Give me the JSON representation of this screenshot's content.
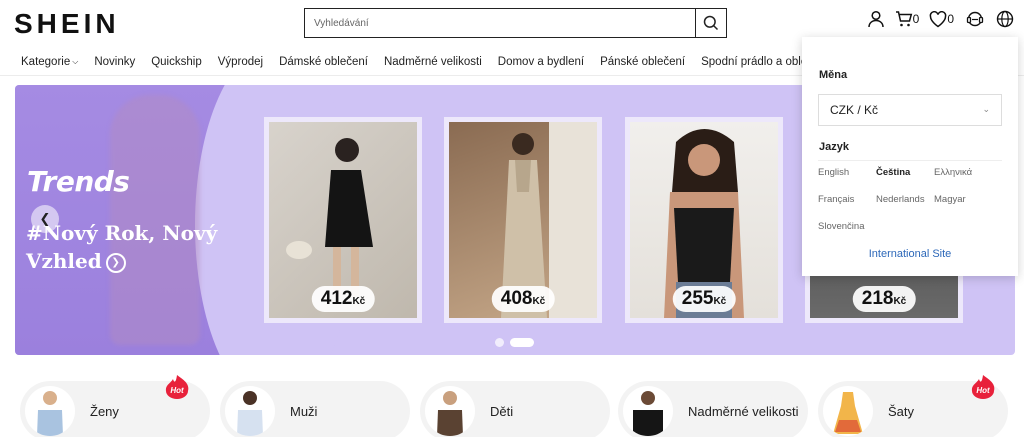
{
  "brand": {
    "logo": "SHEIN"
  },
  "search": {
    "placeholder": "Vyhledávání"
  },
  "header": {
    "cart_count": "0",
    "wishlist_count": "0"
  },
  "nav": {
    "items": [
      "Kategorie",
      "Novinky",
      "Quickship",
      "Výprodej",
      "Dámské oblečení",
      "Nadměrné velikosti",
      "Domov a bydlení",
      "Pánské oblečení",
      "Spodní prádlo a oblečení na s"
    ]
  },
  "banner": {
    "brand_text": "Trends",
    "slogan": "#Nový Rok, Nový Vzhled",
    "products": [
      {
        "price": "412",
        "currency": "Kč"
      },
      {
        "price": "408",
        "currency": "Kč"
      },
      {
        "price": "255",
        "currency": "Kč"
      },
      {
        "price": "218",
        "currency": "Kč"
      }
    ],
    "active_slide": 2,
    "slide_count": 2
  },
  "categories": [
    {
      "label": "Ženy",
      "hot": true
    },
    {
      "label": "Muži",
      "hot": false
    },
    {
      "label": "Děti",
      "hot": false
    },
    {
      "label": "Nadměrné velikosti",
      "hot": false
    },
    {
      "label": "Šaty",
      "hot": true
    }
  ],
  "hot_badge": "Hot",
  "dropdown": {
    "currency_title": "Měna",
    "currency_value": "CZK / Kč",
    "language_title": "Jazyk",
    "languages": [
      "English",
      "Čeština",
      "Ελληνικά",
      "Français",
      "Nederlands",
      "Magyar",
      "Slovenčina"
    ],
    "selected_language": "Čeština",
    "international_link": "International Site"
  },
  "colors": {
    "banner_bg": "#cfc3f5",
    "banner_left": "#a58be3",
    "link": "#2d68b9",
    "hot": "#e8213b"
  }
}
